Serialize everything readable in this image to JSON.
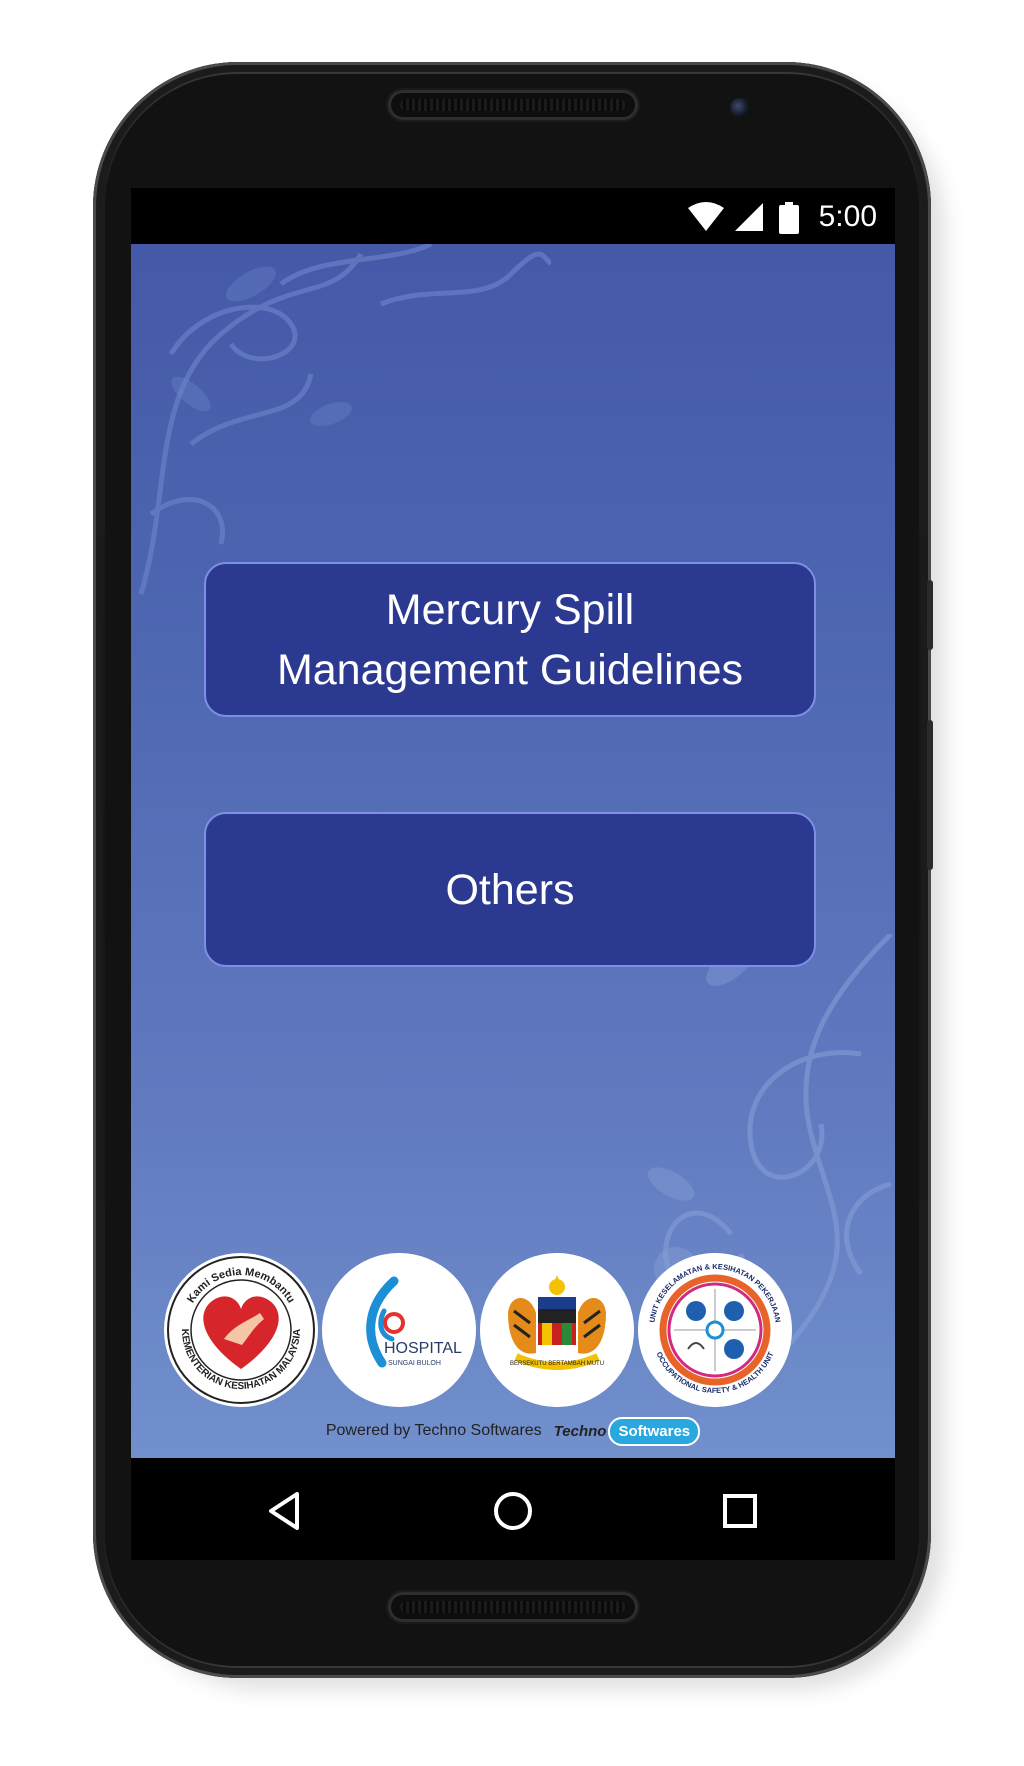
{
  "status_bar": {
    "time": "5:00",
    "icons": [
      "wifi-icon",
      "signal-icon",
      "battery-icon"
    ]
  },
  "menu": {
    "buttons": [
      {
        "label": "Mercury Spill\nManagement Guidelines"
      },
      {
        "label": "Others"
      }
    ]
  },
  "logos": [
    {
      "top_text": "Kami Sedia Membantu",
      "bottom_text": "KEMENTERIAN KESIHATAN MALAYSIA"
    },
    {
      "text": "HOSPITAL",
      "sub_text": "SUNGAI BULOH"
    },
    {
      "motto": "BERSEKUTU BERTAMBAH MUTU"
    },
    {
      "top_text": "UNIT KESELAMATAN & KESIHATAN PEKERJAAN",
      "bottom_text": "OCCUPATIONAL SAFETY & HEALTH UNIT"
    }
  ],
  "footer": {
    "powered_text": "Powered by Techno Softwares",
    "brand_part1": "Techno",
    "brand_part2": "Softwares"
  },
  "navigation": [
    "back-icon",
    "home-icon",
    "recents-icon"
  ],
  "colors": {
    "button_bg": "#2c3990",
    "button_border": "#7e8fe6",
    "background_top": "#4459a8",
    "background_bottom": "#7190cc"
  }
}
